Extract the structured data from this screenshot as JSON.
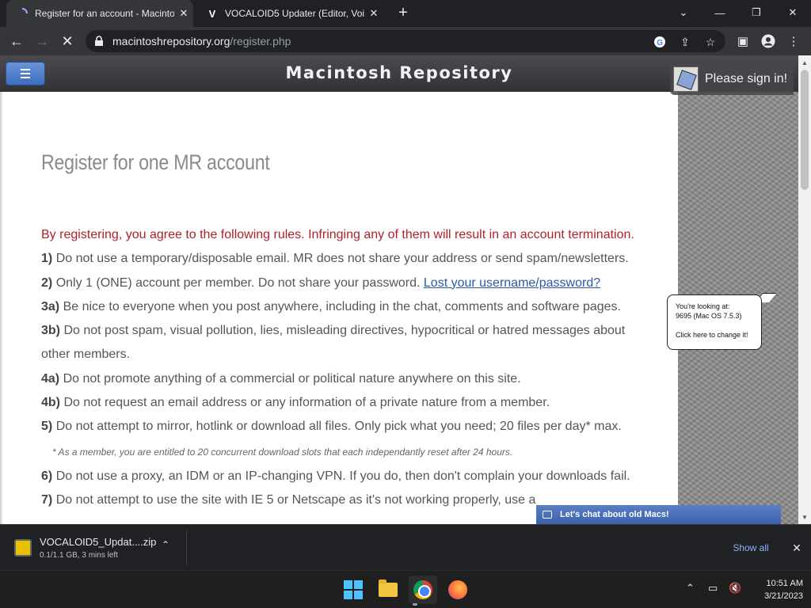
{
  "browser": {
    "tabs": [
      {
        "title": "Register for an account - Macintosh Repository",
        "favicon": "loading-spinner",
        "active": true
      },
      {
        "title": "VOCALOID5 Updater (Editor, Voice",
        "favicon": "V",
        "active": false
      }
    ],
    "url_host": "macintoshrepository.org",
    "url_path": "/register.php"
  },
  "site": {
    "title": "Macintosh Repository",
    "signin_label": "Please sign in!"
  },
  "page": {
    "heading": "Register for one MR account",
    "intro": "By registering, you agree to the following rules. Infringing any of them will result in an account termination.",
    "rules": [
      {
        "num": "1)",
        "text": "Do not use a temporary/disposable email. MR does not share your address or send spam/newsletters."
      },
      {
        "num": "2)",
        "text": "Only 1 (ONE) account per member. Do not share your password. ",
        "link": "Lost your username/password?"
      },
      {
        "num": "3a)",
        "text": "Be nice to everyone when you post anywhere, including in the chat, comments and software pages."
      },
      {
        "num": "3b)",
        "text": "Do not post spam, visual pollution, lies, misleading directives, hypocritical or hatred messages about other members."
      },
      {
        "num": "4a)",
        "text": "Do not promote anything of a commercial or political nature anywhere on this site."
      },
      {
        "num": "4b)",
        "text": "Do not request an email address or any information of a private nature from a member."
      },
      {
        "num": "5)",
        "text": "Do not attempt to mirror, hotlink or download all files. Only pick what you need; 20 files per day* max."
      },
      {
        "num": "6)",
        "text": "Do not use a proxy, an IDM or an IP-changing VPN. If you do, then don't complain your downloads fail."
      },
      {
        "num": "7)",
        "text": "Do not attempt to use the site with IE 5 or Netscape as it's not working properly, use a"
      }
    ],
    "footnote": "* As a member, you are entitled to 20 concurrent download slots that each independantly reset after 24 hours."
  },
  "bubble": {
    "line1": "You're looking at:",
    "line2": "9695 (Mac OS 7.5.3)",
    "line3": "Click here to change it!"
  },
  "chat": {
    "label": "Let's chat about old Macs!"
  },
  "downloads": {
    "filename": "VOCALOID5_Updat....zip",
    "status": "0.1/1.1 GB, 3 mins left",
    "show_all": "Show all"
  },
  "taskbar": {
    "time": "10:51 AM",
    "date": "3/21/2023"
  },
  "colors": {
    "intro_red": "#b0202b",
    "link_blue": "#2a58a8",
    "menu_button": "#4a7cc9",
    "chat_bar": "#4a6fb8"
  }
}
